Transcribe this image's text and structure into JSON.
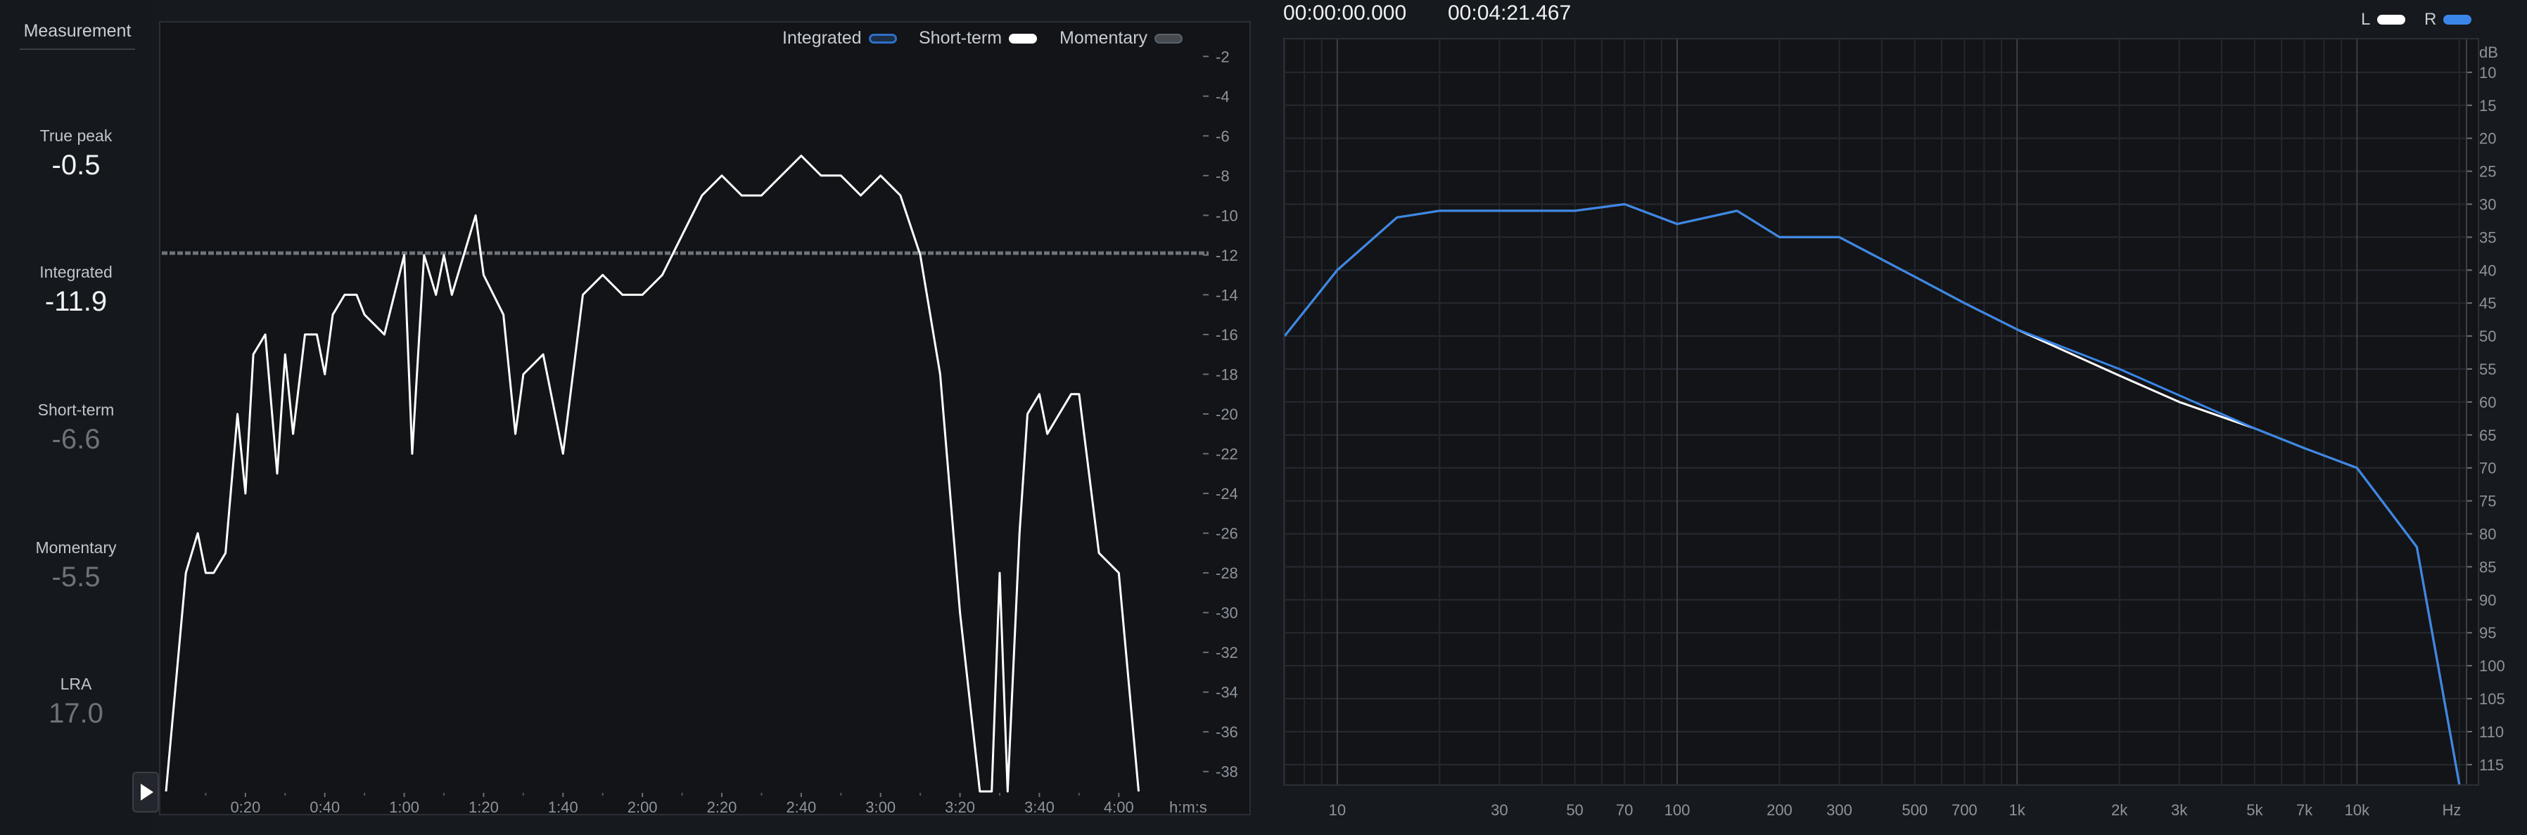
{
  "sidebar": {
    "title": "Measurement",
    "stats": [
      {
        "label": "True peak",
        "value": "-0.5"
      },
      {
        "label": "Integrated",
        "value": "-11.9"
      },
      {
        "label": "Short-term",
        "value": "-6.6"
      },
      {
        "label": "Momentary",
        "value": "-5.5"
      },
      {
        "label": "LRA",
        "value": "17.0"
      }
    ]
  },
  "loudness_graph": {
    "legend": [
      {
        "label": "Integrated",
        "color": "#2f6fc8"
      },
      {
        "label": "Short-term",
        "color": "#ffffff"
      },
      {
        "label": "Momentary",
        "color": "#5a6068"
      }
    ],
    "y_ticks": [
      "-2",
      "-4",
      "-6",
      "-8",
      "-10",
      "-12",
      "-14",
      "-16",
      "-18",
      "-20",
      "-22",
      "-24",
      "-26",
      "-28",
      "-30",
      "-32",
      "-34",
      "-36",
      "-38"
    ],
    "x_ticks": [
      "0:20",
      "0:40",
      "1:00",
      "1:20",
      "1:40",
      "2:00",
      "2:20",
      "2:40",
      "3:00",
      "3:20",
      "3:40",
      "4:00"
    ],
    "x_unit": "h:m:s",
    "integrated_level": -11.9
  },
  "spectrum": {
    "time_start": "00:00:00.000",
    "time_end": "00:04:21.467",
    "channels": [
      {
        "label": "L",
        "color": "#ffffff"
      },
      {
        "label": "R",
        "color": "#3a86e8"
      }
    ],
    "y_unit": "dB",
    "y_ticks": [
      "10",
      "15",
      "20",
      "25",
      "30",
      "35",
      "40",
      "45",
      "50",
      "55",
      "60",
      "65",
      "70",
      "75",
      "80",
      "85",
      "90",
      "95",
      "100",
      "105",
      "110",
      "115"
    ],
    "x_ticks": [
      "10",
      "30",
      "50",
      "70",
      "100",
      "200",
      "300",
      "500",
      "700",
      "1k",
      "2k",
      "3k",
      "5k",
      "7k",
      "10k"
    ],
    "x_unit": "Hz"
  },
  "chart_data": [
    {
      "type": "line",
      "x_unit": "seconds",
      "ylim": [
        -39,
        0
      ],
      "series": [
        {
          "name": "Short-term",
          "x": [
            0,
            5,
            8,
            10,
            12,
            15,
            18,
            20,
            22,
            25,
            28,
            30,
            32,
            35,
            38,
            40,
            42,
            45,
            48,
            50,
            55,
            60,
            62,
            65,
            68,
            70,
            72,
            75,
            78,
            80,
            85,
            88,
            90,
            95,
            100,
            105,
            110,
            115,
            120,
            125,
            130,
            135,
            140,
            145,
            150,
            155,
            160,
            165,
            170,
            175,
            180,
            185,
            190,
            195,
            200,
            205,
            208,
            210,
            212,
            215,
            217,
            220,
            222,
            225,
            228,
            230,
            235,
            240,
            245
          ],
          "y": [
            -39,
            -28,
            -26,
            -28,
            -28,
            -27,
            -20,
            -24,
            -17,
            -16,
            -23,
            -17,
            -21,
            -16,
            -16,
            -18,
            -15,
            -14,
            -14,
            -15,
            -16,
            -12,
            -22,
            -12,
            -14,
            -12,
            -14,
            -12,
            -10,
            -13,
            -15,
            -21,
            -18,
            -17,
            -22,
            -14,
            -13,
            -14,
            -14,
            -13,
            -11,
            -9,
            -8,
            -9,
            -9,
            -8,
            -7,
            -8,
            -8,
            -9,
            -8,
            -9,
            -12,
            -18,
            -30,
            -40,
            -39,
            -28,
            -40,
            -26,
            -20,
            -19,
            -21,
            -20,
            -19,
            -19,
            -27,
            -28,
            -39
          ]
        }
      ]
    },
    {
      "type": "line",
      "x_unit": "Hz",
      "y_unit": "dB",
      "ylim": [
        -118,
        -5
      ],
      "series": [
        {
          "name": "L",
          "x": [
            7,
            10,
            15,
            20,
            30,
            50,
            70,
            100,
            150,
            200,
            300,
            500,
            700,
            1000,
            2000,
            3000,
            5000,
            7000,
            10000,
            15000,
            20000
          ],
          "y": [
            -50,
            -40,
            -32,
            -31,
            -31,
            -31,
            -30,
            -33,
            -31,
            -35,
            -35,
            -41,
            -45,
            -49,
            -56,
            -60,
            -64,
            -67,
            -70,
            -82,
            -118
          ]
        },
        {
          "name": "R",
          "x": [
            7,
            10,
            15,
            20,
            30,
            50,
            70,
            100,
            150,
            200,
            300,
            500,
            700,
            1000,
            2000,
            3000,
            5000,
            7000,
            10000,
            15000,
            20000
          ],
          "y": [
            -50,
            -40,
            -32,
            -31,
            -31,
            -31,
            -30,
            -33,
            -31,
            -35,
            -35,
            -41,
            -45,
            -49,
            -55,
            -59,
            -64,
            -67,
            -70,
            -82,
            -118
          ]
        }
      ]
    }
  ]
}
